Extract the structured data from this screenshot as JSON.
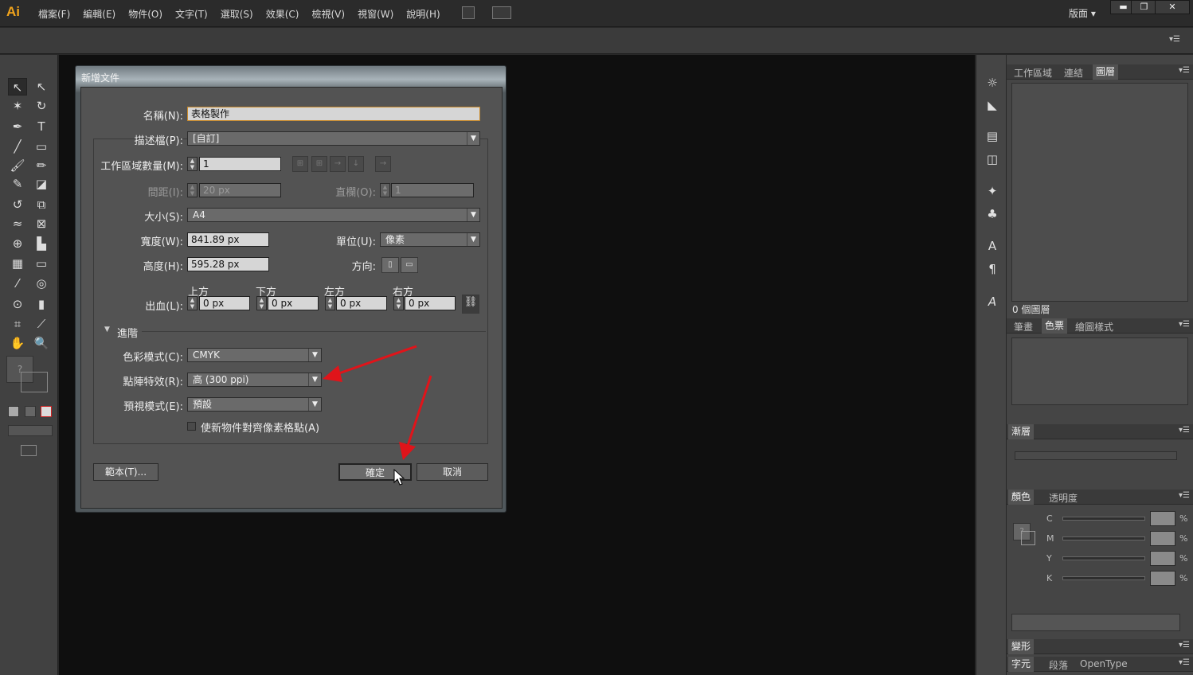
{
  "app": {
    "logo": "Ai",
    "menus": [
      "檔案(F)",
      "編輯(E)",
      "物件(O)",
      "文字(T)",
      "選取(S)",
      "效果(C)",
      "檢視(V)",
      "視窗(W)",
      "說明(H)"
    ],
    "layout_menu": "版面 ▾",
    "win_min": "▬",
    "win_max": "❐",
    "win_close": "✕"
  },
  "dialog": {
    "title": "新增文件",
    "name_label": "名稱(N):",
    "name_value": "表格製作",
    "profile_label": "描述檔(P):",
    "profile_value": "[自訂]",
    "artboards_label": "工作區域數量(M):",
    "artboards_value": "1",
    "spacing_label": "間距(I):",
    "spacing_value": "20 px",
    "columns_label": "直欄(O):",
    "columns_value": "1",
    "size_label": "大小(S):",
    "size_value": "A4",
    "width_label": "寬度(W):",
    "width_value": "841.89 px",
    "units_label": "單位(U):",
    "units_value": "像素",
    "height_label": "高度(H):",
    "height_value": "595.28 px",
    "orientation_label": "方向:",
    "bleed_label": "出血(L):",
    "bleed": [
      {
        "label": "上方",
        "value": "0 px"
      },
      {
        "label": "下方",
        "value": "0 px"
      },
      {
        "label": "左方",
        "value": "0 px"
      },
      {
        "label": "右方",
        "value": "0 px"
      }
    ],
    "advanced_label": "進階",
    "color_mode_label": "色彩模式(C):",
    "color_mode_value": "CMYK",
    "raster_label": "點陣特效(R):",
    "raster_value": "高 (300 ppi)",
    "preview_label": "預視模式(E):",
    "preview_value": "預設",
    "align_pixel_label": "使新物件對齊像素格點(A)",
    "templates_button": "範本(T)...",
    "ok_button": "確定",
    "cancel_button": "取消"
  },
  "panels": {
    "layers_tabs": [
      "工作區域",
      "連結",
      "圖層"
    ],
    "layers_count": "0 個圖層",
    "swatch_tabs": [
      "筆畫",
      "色票",
      "繪圖樣式"
    ],
    "gradient_tab": "漸層",
    "color_tabs": [
      "顏色",
      "透明度"
    ],
    "cmyk_labels": [
      "C",
      "M",
      "Y",
      "K"
    ],
    "percent": "%",
    "transform_tab": "變形",
    "char_tabs": [
      "字元",
      "段落",
      "OpenType"
    ]
  },
  "colors": {
    "accent": "#f0a31c",
    "arrow": "#e0141a",
    "canvas": "#0f0f0f"
  }
}
